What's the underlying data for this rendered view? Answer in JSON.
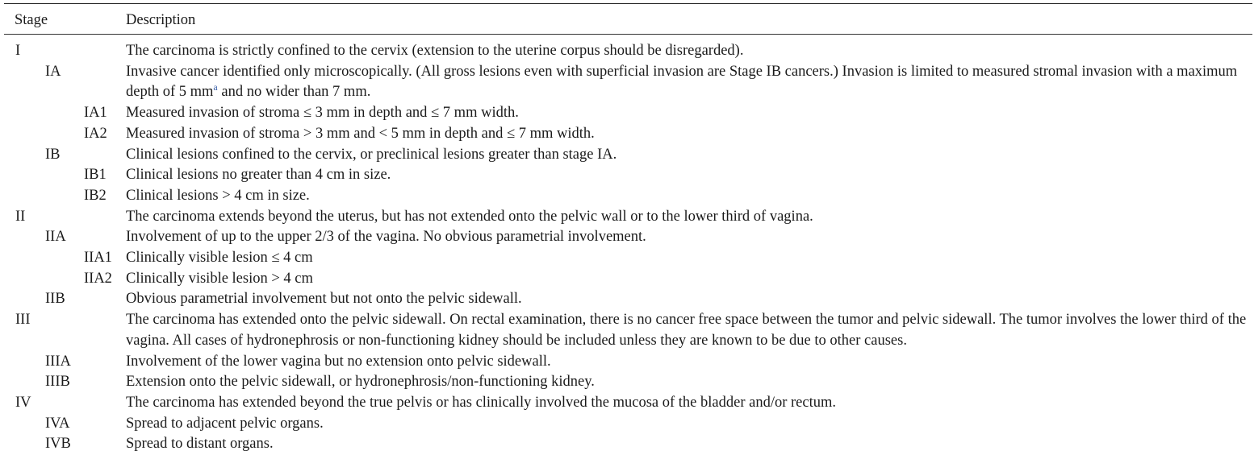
{
  "table": {
    "header": {
      "stage": "Stage",
      "description": "Description"
    },
    "rows": [
      {
        "level": 1,
        "stage": "I",
        "description": "The carcinoma is strictly confined to the cervix (extension to the uterine corpus should be disregarded)."
      },
      {
        "level": 2,
        "stage": "IA",
        "description_pre": "Invasive cancer identified only microscopically. (All gross lesions even with superficial invasion are Stage IB cancers.) Invasion is limited to measured stromal invasion with a maximum depth of 5 mm",
        "footnote": "a",
        "description_post": " and no wider than 7 mm."
      },
      {
        "level": 3,
        "stage": "IA1",
        "description": "Measured invasion of stroma ≤ 3 mm in depth and ≤ 7 mm width."
      },
      {
        "level": 3,
        "stage": "IA2",
        "description": "Measured invasion of stroma > 3 mm and < 5 mm in depth and ≤ 7 mm width."
      },
      {
        "level": 2,
        "stage": "IB",
        "description": "Clinical lesions confined to the cervix, or preclinical lesions greater than stage IA."
      },
      {
        "level": 3,
        "stage": "IB1",
        "description": "Clinical lesions no greater than 4 cm in size."
      },
      {
        "level": 3,
        "stage": "IB2",
        "description": "Clinical lesions > 4 cm in size."
      },
      {
        "level": 1,
        "stage": "II",
        "description": "The carcinoma extends beyond the uterus, but has not extended onto the pelvic wall or to the lower third of vagina."
      },
      {
        "level": 2,
        "stage": "IIA",
        "description": "Involvement of up to the upper 2/3 of the vagina. No obvious parametrial involvement."
      },
      {
        "level": 3,
        "stage": "IIA1",
        "description": "Clinically visible lesion ≤ 4 cm"
      },
      {
        "level": 3,
        "stage": "IIA2",
        "description": "Clinically visible lesion > 4 cm"
      },
      {
        "level": 2,
        "stage": "IIB",
        "description": "Obvious parametrial involvement but not onto the pelvic sidewall."
      },
      {
        "level": 1,
        "stage": "III",
        "description": "The carcinoma has extended onto the pelvic sidewall. On rectal examination, there is no cancer free space between the tumor and pelvic sidewall. The tumor involves the lower third of the vagina. All cases of hydronephrosis or non-functioning kidney should be included unless they are known to be due to other causes."
      },
      {
        "level": 2,
        "stage": "IIIA",
        "description": "Involvement of the lower vagina but no extension onto pelvic sidewall."
      },
      {
        "level": 2,
        "stage": "IIIB",
        "description": "Extension onto the pelvic sidewall, or hydronephrosis/non-functioning kidney."
      },
      {
        "level": 1,
        "stage": "IV",
        "description": "The carcinoma has extended beyond the true pelvis or has clinically involved the mucosa of the bladder and/or rectum."
      },
      {
        "level": 2,
        "stage": "IVA",
        "description": "Spread to adjacent pelvic organs."
      },
      {
        "level": 2,
        "stage": "IVB",
        "description": "Spread to distant organs."
      }
    ]
  }
}
